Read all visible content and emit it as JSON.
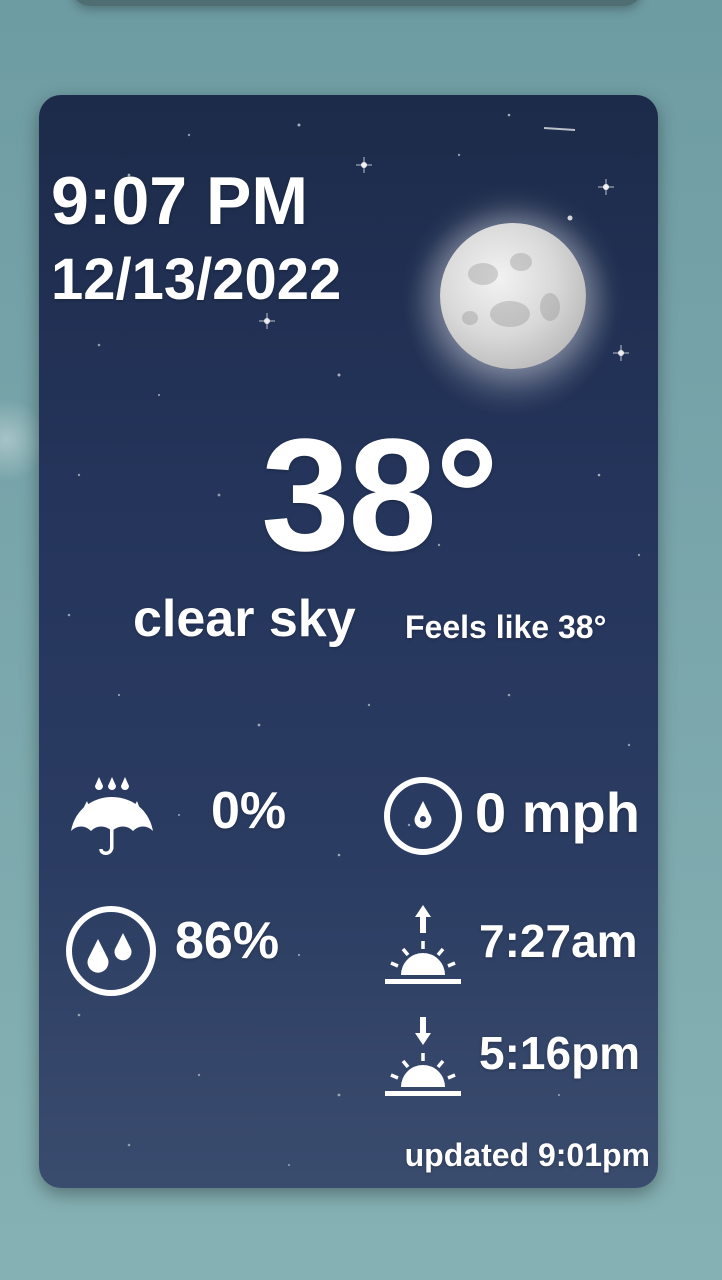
{
  "widget": {
    "time": "9:07 PM",
    "date": "12/13/2022",
    "temperature": "38°",
    "condition": "clear sky",
    "feels_like": "Feels like 38°",
    "precipitation": "0%",
    "humidity": "86%",
    "wind": "0 mph",
    "sunrise": "7:27am",
    "sunset": "5:16pm",
    "updated": "updated 9:01pm"
  },
  "icons": {
    "weather_art": "moon-icon",
    "precipitation": "umbrella-rain-icon",
    "humidity": "water-drops-icon",
    "wind": "wind-direction-icon",
    "sunrise": "sunrise-icon",
    "sunset": "sunset-icon"
  },
  "colors": {
    "page_background": "#79a6ab",
    "card_background": "#24345a",
    "text": "#ffffff"
  }
}
